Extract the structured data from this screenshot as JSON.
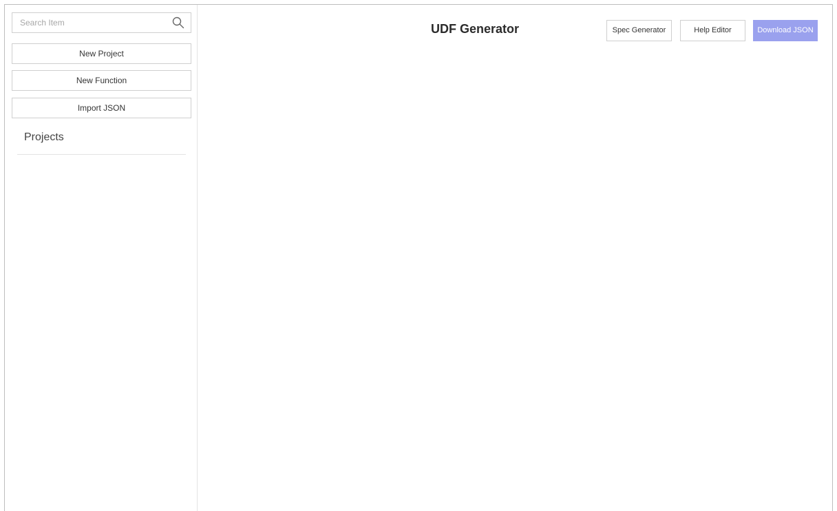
{
  "sidebar": {
    "search": {
      "placeholder": "Search Item",
      "value": "",
      "icon": "search-icon"
    },
    "buttons": [
      {
        "label": "New Project"
      },
      {
        "label": "New Function"
      },
      {
        "label": "Import JSON"
      }
    ],
    "projects_title": "Projects"
  },
  "header": {
    "title": "UDF Generator",
    "buttons": {
      "spec_generator": "Spec Generator",
      "help_editor": "Help Editor",
      "download_json": "Download JSON"
    }
  },
  "colors": {
    "accent": "#9aa1ee",
    "border": "#cfcfcf",
    "divider": "#e3e3e3"
  }
}
